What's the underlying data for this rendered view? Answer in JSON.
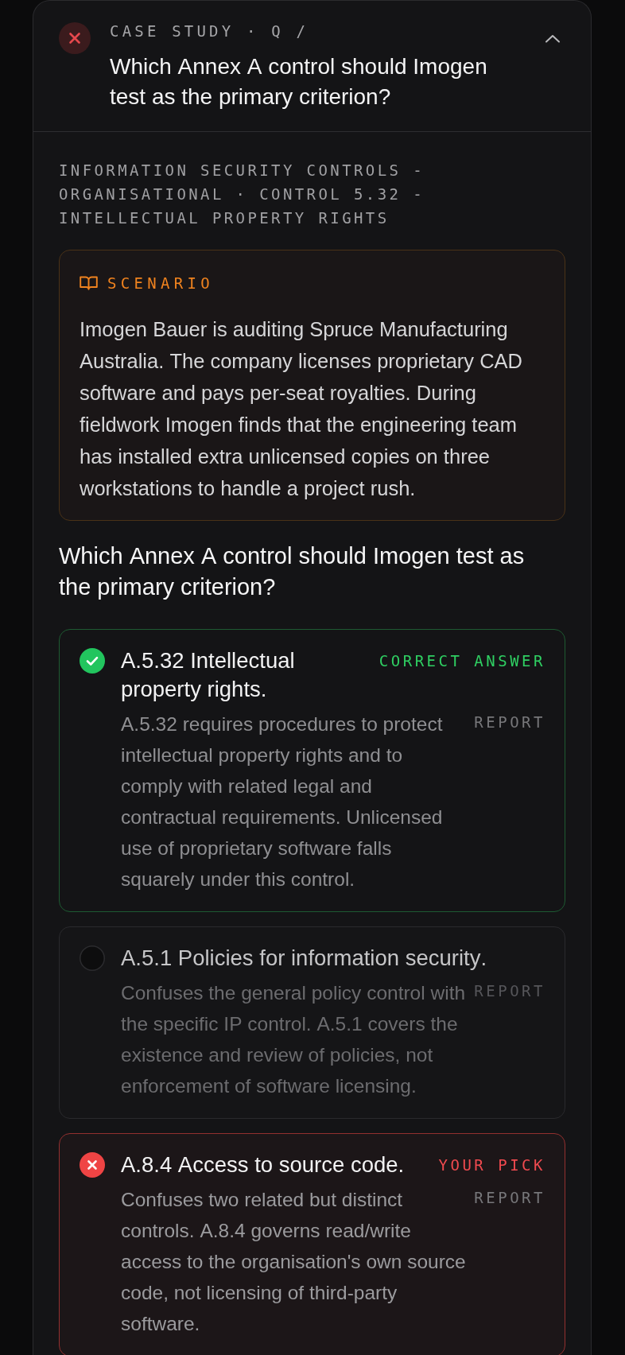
{
  "header": {
    "answered_correctly": false,
    "eyebrow": "CASE STUDY · Q /",
    "title": "Which Annex A control should Imogen test as the primary criterion?",
    "expanded": true
  },
  "breadcrumb": "INFORMATION SECURITY CONTROLS - ORGANISATIONAL · CONTROL 5.32 - INTELLECTUAL PROPERTY RIGHTS",
  "scenario": {
    "label": "SCENARIO",
    "text": "Imogen Bauer is auditing Spruce Manufacturing Australia. The company licenses proprietary CAD software and pays per-seat royalties. During fieldwork Imogen finds that the engineering team has installed extra unlicensed copies on three workstations to handle a project rush."
  },
  "question": "Which Annex A control should Imogen test as the primary criterion?",
  "options": [
    {
      "title": "A.5.32 Intellectual property rights.",
      "tag": "CORRECT ANSWER",
      "explanation": "A.5.32 requires procedures to protect intellectual property rights and to comply with related legal and contractual requirements. Unlicensed use of proprietary software falls squarely under this control.",
      "report": "REPORT",
      "correct": true,
      "selected": false
    },
    {
      "title": "A.5.1 Policies for information security.",
      "explanation": "Confuses the general policy control with the specific IP control. A.5.1 covers the existence and review of policies, not enforcement of software licensing.",
      "report": "REPORT",
      "correct": false,
      "selected": false
    },
    {
      "title": "A.8.4 Access to source code.",
      "tag": "YOUR PICK",
      "explanation": "Confuses two related but distinct controls. A.8.4 governs read/write access to the organisation's own source code, not licensing of third-party software.",
      "report": "REPORT",
      "correct": false,
      "selected": true
    }
  ]
}
